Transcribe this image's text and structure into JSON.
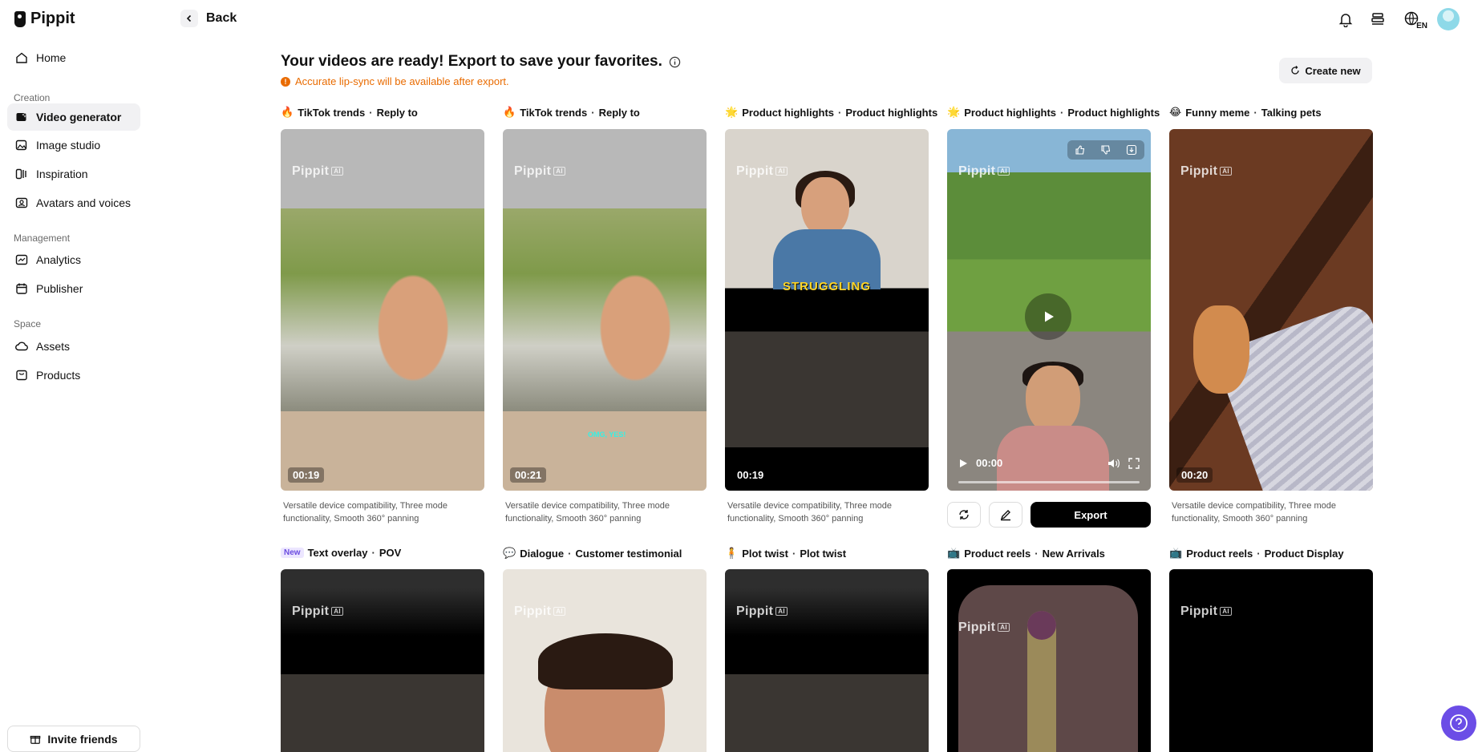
{
  "app": {
    "name": "Pippit"
  },
  "sidebar": {
    "home": "Home",
    "sections": {
      "creation": "Creation",
      "management": "Management",
      "space": "Space"
    },
    "items": {
      "video_generator": "Video generator",
      "image_studio": "Image studio",
      "inspiration": "Inspiration",
      "avatars_voices": "Avatars and voices",
      "analytics": "Analytics",
      "publisher": "Publisher",
      "assets": "Assets",
      "products": "Products"
    },
    "invite": "Invite friends"
  },
  "topbar": {
    "back": "Back",
    "language": "EN"
  },
  "main": {
    "heading": "Your videos are ready! Export to save your favorites.",
    "notice": "Accurate lip-sync will be available after export.",
    "create_new": "Create new",
    "watermark": "Pippit",
    "watermark_badge": "AI"
  },
  "cards_row1": [
    {
      "emoji": "🔥",
      "category": "TikTok trends",
      "sub": "Reply to",
      "duration": "00:19",
      "desc": "Versatile device compatibility, Three mode functionality, Smooth 360° panning"
    },
    {
      "emoji": "🔥",
      "category": "TikTok trends",
      "sub": "Reply to",
      "duration": "00:21",
      "overlay": "OMG, YES!",
      "desc": "Versatile device compatibility, Three mode functionality, Smooth 360° panning"
    },
    {
      "emoji": "🌟",
      "category": "Product highlights",
      "sub": "Product highlights",
      "duration": "00:19",
      "overlay": "STRUGGLING",
      "desc": "Versatile device compatibility, Three mode functionality, Smooth 360° panning"
    },
    {
      "emoji": "🌟",
      "category": "Product highlights",
      "sub": "Product highlights",
      "time": "00:00",
      "export": "Export"
    },
    {
      "emoji": "😂",
      "category": "Funny meme",
      "sub": "Talking pets",
      "duration": "00:20",
      "desc": "Versatile device compatibility, Three mode functionality, Smooth 360° panning"
    }
  ],
  "cards_row2": [
    {
      "badge": "New",
      "category": "Text overlay",
      "sub": "POV"
    },
    {
      "emoji": "💬",
      "category": "Dialogue",
      "sub": "Customer testimonial"
    },
    {
      "emoji": "🧍",
      "category": "Plot twist",
      "sub": "Plot twist"
    },
    {
      "emoji": "📺",
      "category": "Product reels",
      "sub": "New Arrivals"
    },
    {
      "emoji": "📺",
      "category": "Product reels",
      "sub": "Product Display"
    }
  ],
  "colors": {
    "accent_purple": "#6b4de6",
    "notice_orange": "#e96b00"
  }
}
